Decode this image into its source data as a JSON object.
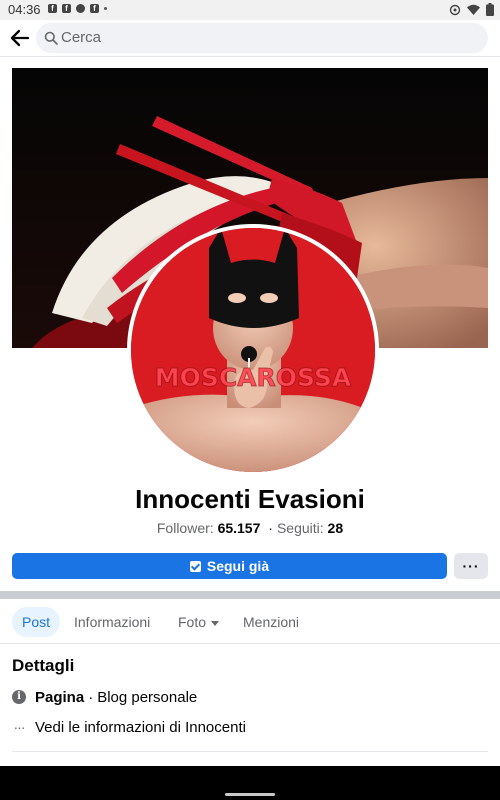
{
  "status_bar": {
    "time": "04:36",
    "notification_icons": [
      "facebook-icon",
      "facebook-icon",
      "messenger-icon",
      "facebook-icon"
    ],
    "system_icons": [
      "alarm-icon",
      "wifi-icon",
      "battery-icon"
    ]
  },
  "app_bar": {
    "back_icon": "arrow-left-icon",
    "search": {
      "placeholder": "Cerca",
      "icon": "search-icon"
    }
  },
  "avatar": {
    "logo_text": "MOSCAROSSA"
  },
  "profile": {
    "name": "Innocenti Evasioni",
    "followers_label": "Follower:",
    "followers_value": "65.157",
    "following_label": "Seguiti:",
    "following_value": "28"
  },
  "actions": {
    "follow_label": "Segui già",
    "more_label": "···"
  },
  "tabs": [
    {
      "label": "Post",
      "active": true
    },
    {
      "label": "Informazioni",
      "active": false
    },
    {
      "label": "Foto",
      "active": false,
      "dropdown": true
    },
    {
      "label": "Menzioni",
      "active": false
    }
  ],
  "details": {
    "title": "Dettagli",
    "category_label": "Pagina",
    "category_value": "Blog personale",
    "see_info_label": "Vedi le informazioni di Innocenti"
  },
  "colors": {
    "accent": "#1b74e4",
    "avatar_bg": "#d81c22",
    "tab_active_bg": "#e7f3ff"
  }
}
